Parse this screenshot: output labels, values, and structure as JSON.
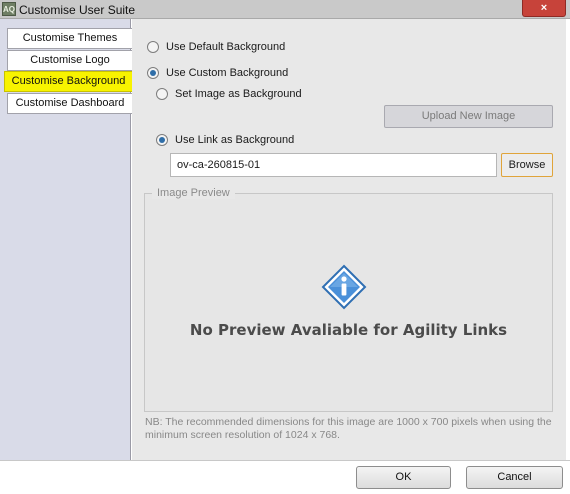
{
  "window": {
    "title": "Customise User Suite",
    "app_icon_text": "AQ",
    "close_symbol": "×"
  },
  "sidebar": {
    "tabs": [
      {
        "label": "Customise Themes",
        "active": false
      },
      {
        "label": "Customise Logo",
        "active": false
      },
      {
        "label": "Customise Background",
        "active": true
      },
      {
        "label": "Customise Dashboard",
        "active": false
      }
    ]
  },
  "background": {
    "default_option": {
      "label": "Use Default Background",
      "selected": false
    },
    "custom_option": {
      "label": "Use Custom Background",
      "selected": true
    },
    "image_option": {
      "label": "Set Image as Background",
      "selected": false
    },
    "upload_button": {
      "label": "Upload New Image",
      "enabled": false
    },
    "link_option": {
      "label": "Use Link as Background",
      "selected": true
    },
    "link_value": "ov-ca-260815-01",
    "browse_button": {
      "label": "Browse"
    }
  },
  "preview": {
    "legend": "Image Preview",
    "icon": "info-diamond-icon",
    "message": "No Preview Avaliable for Agility Links"
  },
  "note": "NB: The recommended dimensions for this image are 1000 x 700 pixels when using the minimum screen resolution of 1024 x 768.",
  "footer": {
    "ok_label": "OK",
    "cancel_label": "Cancel"
  },
  "colors": {
    "active_tab": "#f8f300",
    "close_button": "#c7433a",
    "info_icon": "#4a90d9"
  }
}
